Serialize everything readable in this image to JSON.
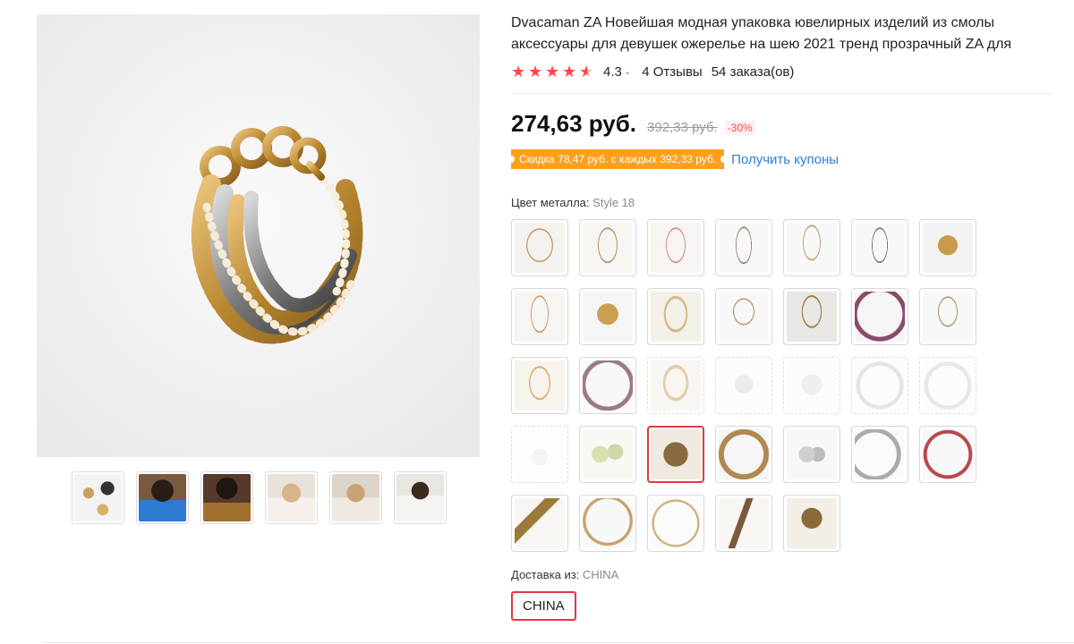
{
  "product": {
    "title": "Dvacaman ZA Новейшая модная упаковка ювелирных изделий из смолы аксессуары для девушек ожерелье на шею 2021 тренд прозрачный ZA для женщин",
    "rating": {
      "stars": 4.5,
      "value": "4.3",
      "reviews": "4 Отзывы",
      "orders": "54 заказа(ов)"
    },
    "price": {
      "current": "274,63 руб.",
      "old": "392,33 руб.",
      "discount": "-30%"
    },
    "coupon": {
      "badge": "Скидка 78,47 руб. с каждых 392,33 руб.",
      "link": "Получить купоны"
    },
    "metal_color": {
      "label": "Цвет металла:",
      "selected": "Style 18",
      "count": 33,
      "selected_index": 23
    },
    "shipping": {
      "label": "Доставка из:",
      "selected": "CHINA",
      "option": "CHINA"
    }
  },
  "gallery": {
    "thumb_count": 6
  },
  "colors": {
    "accent": "#ff4747",
    "selected_border": "#e4393c",
    "coupon_bg": "#ff9f1a",
    "link": "#2e7cd8"
  }
}
